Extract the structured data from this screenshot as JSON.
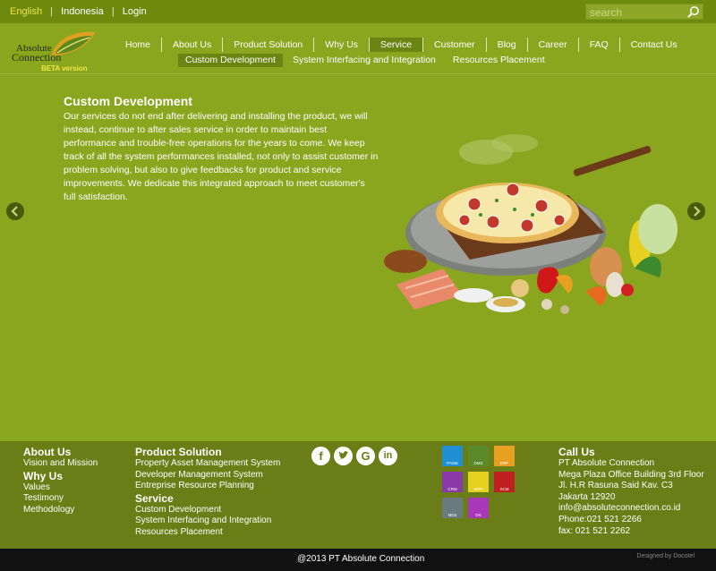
{
  "topbar": {
    "languages": [
      {
        "label": "English",
        "active": true
      },
      {
        "label": "Indonesia",
        "active": false
      }
    ],
    "login": "Login",
    "search_placeholder": "search"
  },
  "logo": {
    "line1": "Absolute",
    "line2": "Connection",
    "beta": "BETA version"
  },
  "nav": {
    "items": [
      {
        "label": "Home",
        "active": false
      },
      {
        "label": "About Us",
        "active": false
      },
      {
        "label": "Product Solution",
        "active": false
      },
      {
        "label": "Why Us",
        "active": false
      },
      {
        "label": "Service",
        "active": true
      },
      {
        "label": "Customer",
        "active": false
      },
      {
        "label": "Blog",
        "active": false
      },
      {
        "label": "Career",
        "active": false
      },
      {
        "label": "FAQ",
        "active": false
      },
      {
        "label": "Contact Us",
        "active": false
      }
    ],
    "subitems": [
      {
        "label": "Custom Development",
        "active": true
      },
      {
        "label": "System Interfacing and Integration",
        "active": false
      },
      {
        "label": "Resources Placement",
        "active": false
      }
    ]
  },
  "hero": {
    "title": "Custom Development",
    "text": "Our services do not end after delivering and installing the product, we will instead, continue to after sales service in order to maintain best performance and trouble-free operations for the years to come. We keep track of all the system performances installed, not only to assist customer in problem solving, but also to give feedbacks for product and service improvements. We dedicate this integrated approach to meet customer's full satisfaction."
  },
  "footer": {
    "about": {
      "heading": "About Us",
      "links": [
        "Vision and Mission"
      ]
    },
    "why": {
      "heading": "Why Us",
      "links": [
        "Values",
        "Testimony",
        "Methodology"
      ]
    },
    "product": {
      "heading": "Product Solution",
      "links": [
        "Property Asset Management System",
        "Developer Management System",
        "Entreprise Resource Planning"
      ]
    },
    "service": {
      "heading": "Service",
      "links": [
        "Custom Development",
        "System Interfacing and Integration",
        "Resources Placement"
      ]
    },
    "apps": [
      {
        "label": "PAMS",
        "color": "#1e8fd0"
      },
      {
        "label": "DMS",
        "color": "#5a8a2a"
      },
      {
        "label": "ERP",
        "color": "#e8a020"
      },
      {
        "label": "CRM",
        "color": "#8a3aa8"
      },
      {
        "label": "MRP",
        "color": "#e6d020"
      },
      {
        "label": "SCM",
        "color": "#c02020"
      },
      {
        "label": "MES",
        "color": "#6a7a80"
      },
      {
        "label": "DS",
        "color": "#a838b8"
      }
    ],
    "contact": {
      "heading": "Call Us",
      "lines": [
        "PT Absolute Connection",
        "Mega Plaza Office Building 3rd Floor",
        "Jl. H.R Rasuna Said Kav. C3",
        "Jakarta 12920",
        "info@absoluteconnection.co.id",
        "Phone:021 521 2266",
        "fax: 021 521 2262"
      ]
    },
    "copyright": "@2013 PT Absolute Connection",
    "designed": "Designed by Docotel"
  }
}
